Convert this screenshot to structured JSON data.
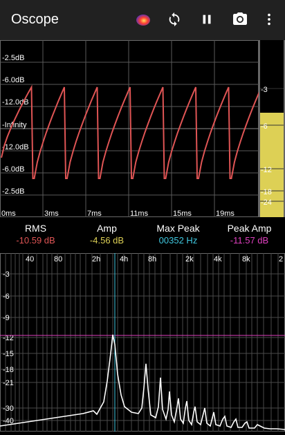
{
  "app": {
    "title": "Oscope"
  },
  "toolbar": {
    "icons": [
      "app-logo-icon",
      "refresh-icon",
      "pause-icon",
      "camera-icon",
      "more-vert-icon"
    ]
  },
  "scope": {
    "y_labels": [
      "-2.5dB",
      "-6.0dB",
      "-12.0dB",
      "-Infinity",
      "-12.0dB",
      "-6.0dB",
      "-2.5dB"
    ],
    "x_labels": [
      "0ms",
      "3ms",
      "7ms",
      "11ms",
      "15ms",
      "19ms"
    ],
    "trace_color": "#e05555"
  },
  "meter": {
    "labels": [
      "-3",
      "-6",
      "-12",
      "-18",
      "-24"
    ],
    "level_color": "#ddd055"
  },
  "stats": {
    "rms": {
      "label": "RMS",
      "value": "-10.59 dB",
      "color": "#e05555"
    },
    "amp": {
      "label": "Amp",
      "value": "-4.56 dB",
      "color": "#ddd055"
    },
    "max_peak": {
      "label": "Max Peak",
      "value": "00352 Hz",
      "color": "#40c8e0"
    },
    "peak_amp": {
      "label": "Peak Amp",
      "value": "-11.57 dB",
      "color": "#e040c0"
    }
  },
  "spectrum": {
    "x_labels": [
      "40",
      "80",
      "2h",
      "4h",
      "8h",
      "2k",
      "4k",
      "8k",
      "2"
    ],
    "y_labels": [
      "-3",
      "-6",
      "-9",
      "-12",
      "-15",
      "-18",
      "-21",
      "-30",
      "-40"
    ],
    "peak_line_color": "#40c8e0",
    "peak_amp_line_color": "#e040c0"
  }
}
